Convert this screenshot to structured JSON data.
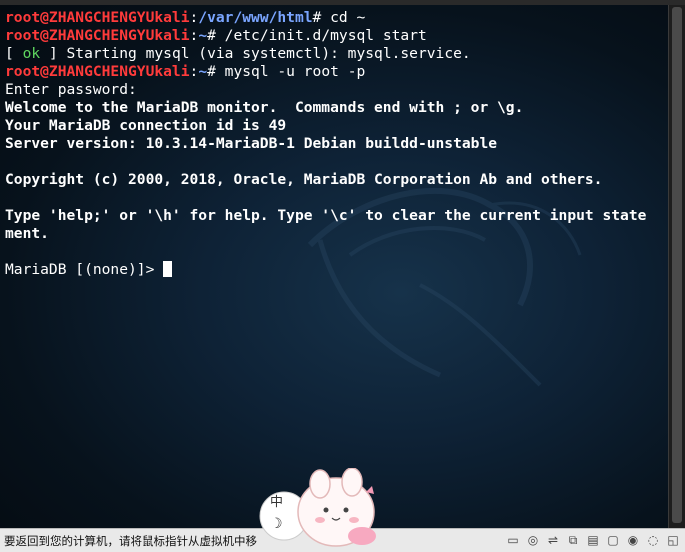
{
  "terminal": {
    "line1": {
      "user": "root@ZHANGCHENGYUkali",
      "colon": ":",
      "path": "/var/www/html",
      "suffix": "# cd ~"
    },
    "line2": {
      "user": "root@ZHANGCHENGYUkali",
      "colon": ":",
      "path": "~",
      "suffix": "# /etc/init.d/mysql start"
    },
    "line3": {
      "open": "[ ",
      "ok": "ok",
      "close": " ] Starting mysql (via systemctl): mysql.service."
    },
    "line4": {
      "user": "root@ZHANGCHENGYUkali",
      "colon": ":",
      "path": "~",
      "suffix": "# mysql -u root -p"
    },
    "line5": "Enter password:",
    "line6": "Welcome to the MariaDB monitor.  Commands end with ; or \\g.",
    "line7": "Your MariaDB connection id is 49",
    "line8": "Server version: 10.3.14-MariaDB-1 Debian buildd-unstable",
    "line9": "",
    "line10": "Copyright (c) 2000, 2018, Oracle, MariaDB Corporation Ab and others.",
    "line11": "",
    "line12": "Type 'help;' or '\\h' for help. Type '\\c' to clear the current input state",
    "line13": "ment.",
    "line14": "",
    "prompt": "MariaDB [(none)]> "
  },
  "statusbar": {
    "message": "要返回到您的计算机，请将鼠标指针从虚拟机中移",
    "ime_label": "中",
    "moon": "☽"
  },
  "tray": [
    {
      "name": "hdd-icon",
      "glyph": "▭"
    },
    {
      "name": "cd-icon",
      "glyph": "◎"
    },
    {
      "name": "usb-icon",
      "glyph": "⇌"
    },
    {
      "name": "network-icon",
      "glyph": "⧉"
    },
    {
      "name": "display-icon",
      "glyph": "▤"
    },
    {
      "name": "shared-folder-icon",
      "glyph": "▢"
    },
    {
      "name": "record-icon",
      "glyph": "◉"
    },
    {
      "name": "capture-icon",
      "glyph": "◌"
    },
    {
      "name": "host-key-icon",
      "glyph": "◱"
    }
  ],
  "colors": {
    "user": "#ff3b3b",
    "path": "#7aa5ff",
    "ok": "#5fd75f",
    "text": "#ffffff"
  }
}
